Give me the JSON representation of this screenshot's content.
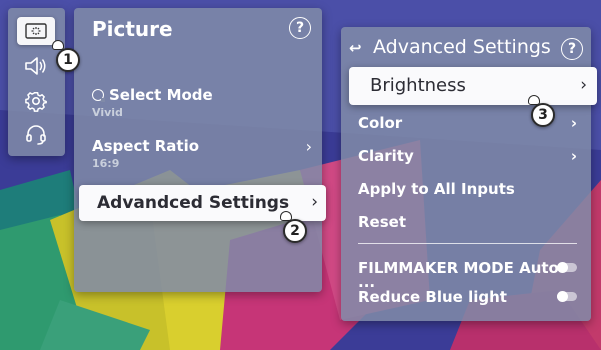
{
  "rail": {
    "items": [
      {
        "icon": "picture-settings-icon",
        "active": true
      },
      {
        "icon": "speaker-icon",
        "active": false
      },
      {
        "icon": "gear-icon",
        "active": false
      },
      {
        "icon": "headset-icon",
        "active": false
      }
    ]
  },
  "picture_panel": {
    "title": "Picture",
    "help_label": "?",
    "items": [
      {
        "label": "Select Mode",
        "value": "Vivid"
      },
      {
        "label": "Aspect Ratio",
        "value": "16:9"
      }
    ],
    "selected_item": "Advandced Settings"
  },
  "advanced_panel": {
    "back_symbol": "↩",
    "title": "Advanced Settings",
    "help_label": "?",
    "selected_item": "Brightness",
    "items": [
      {
        "label": "Color",
        "has_submenu": true
      },
      {
        "label": "Clarity",
        "has_submenu": true
      },
      {
        "label": "Apply to All Inputs",
        "has_submenu": false
      },
      {
        "label": "Reset",
        "has_submenu": false
      }
    ],
    "toggles": [
      {
        "label": "FILMMAKER MODE Auto ···",
        "on": false
      },
      {
        "label": "Reduce Blue light",
        "on": false
      }
    ]
  },
  "chevron": "›",
  "badges": [
    "1",
    "2",
    "3"
  ]
}
